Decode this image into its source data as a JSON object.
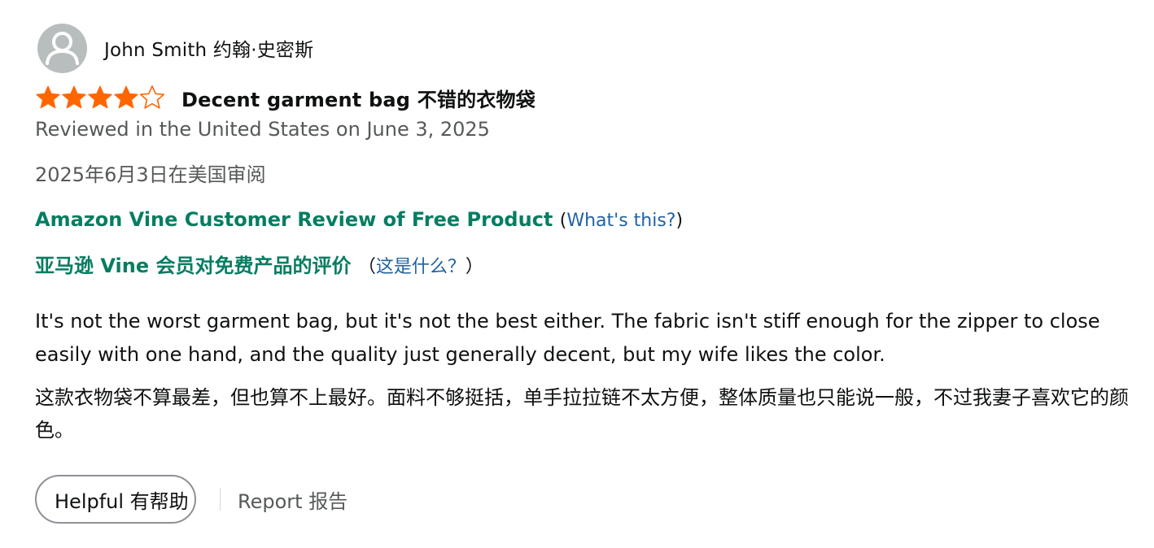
{
  "profile": {
    "name": "John Smith  约翰·史密斯"
  },
  "rating": {
    "value": 4,
    "max": 5,
    "filled_color": "#ff6600",
    "empty_color": "#ff6600"
  },
  "review": {
    "title": "Decent garment bag  不错的衣物袋",
    "date": "Reviewed in the United States on June 3, 2025",
    "date_cn": "2025年6月3日在美国审阅",
    "vine_label": "Amazon Vine Customer Review of Free Product",
    "vine_open_paren": "(",
    "vine_link": "What's this?",
    "vine_close_paren": ")",
    "vine_label_cn": "亚马逊 Vine 会员对免费产品的评价",
    "vine_open_paren_cn": "（",
    "vine_link_cn": "这是什么？",
    "vine_close_paren_cn": "）",
    "body": "It's not the worst garment bag, but it's not the best either. The fabric isn't stiff enough for the zipper to close easily with one hand, and the quality just generally decent, but my wife likes the color.",
    "body_cn": "这款衣物袋不算最差，但也算不上最好。面料不够挺括，单手拉拉链不太方便，整体质量也只能说一般，不过我妻子喜欢它的颜色。"
  },
  "actions": {
    "helpful_label": "Helpful  有帮助",
    "report_label": "Report  报告"
  },
  "colors": {
    "vine_green": "#067d62",
    "link_blue": "#2162a1",
    "secondary_text": "#565959",
    "star_orange": "#ff6600"
  }
}
